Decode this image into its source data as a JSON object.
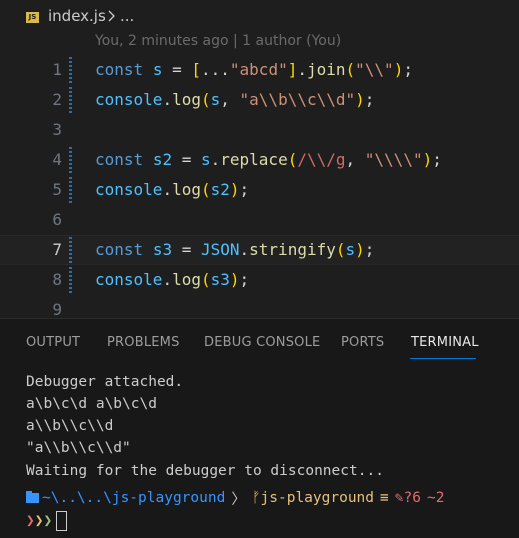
{
  "breadcrumb": {
    "file_badge": "JS",
    "file_name": "index.js",
    "more": "..."
  },
  "editor": {
    "blame": "You, 2 minutes ago | 1 author (You)",
    "active_line": 7,
    "lines": [
      {
        "number": "1",
        "modified": true
      },
      {
        "number": "2",
        "modified": true
      },
      {
        "number": "3",
        "modified": false
      },
      {
        "number": "4",
        "modified": true
      },
      {
        "number": "5",
        "modified": true
      },
      {
        "number": "6",
        "modified": false
      },
      {
        "number": "7",
        "modified": true
      },
      {
        "number": "8",
        "modified": true
      },
      {
        "number": "9",
        "modified": false
      }
    ],
    "code": {
      "l1": {
        "kw": "const",
        "var": "s",
        "eq": " = ",
        "b1o": "[",
        "spread": "...",
        "str": "\"abcd\"",
        "b1c": "]",
        "dot": ".",
        "fn": "join",
        "b2o": "(",
        "arg": "\"\\\\\"",
        "b2c": ")",
        "end": ";"
      },
      "l2": {
        "obj": "console",
        "dot": ".",
        "fn": "log",
        "b1o": "(",
        "var": "s",
        "comma": ", ",
        "str": "\"a\\\\b\\\\c\\\\d\"",
        "b1c": ")",
        "end": ";"
      },
      "l4": {
        "kw": "const",
        "var": "s2",
        "eq": " = ",
        "obj": "s",
        "dot": ".",
        "fn": "replace",
        "b1o": "(",
        "re": "/\\\\/g",
        "comma": ", ",
        "str": "\"\\\\\\\\\"",
        "b1c": ")",
        "end": ";"
      },
      "l5": {
        "obj": "console",
        "dot": ".",
        "fn": "log",
        "b1o": "(",
        "var": "s2",
        "b1c": ")",
        "end": ";"
      },
      "l7": {
        "kw": "const",
        "var": "s3",
        "eq": " = ",
        "obj": "JSON",
        "dot": ".",
        "fn": "stringify",
        "b1o": "(",
        "arg": "s",
        "b1c": ")",
        "end": ";"
      },
      "l8": {
        "obj": "console",
        "dot": ".",
        "fn": "log",
        "b1o": "(",
        "var": "s3",
        "b1c": ")",
        "end": ";"
      }
    }
  },
  "panel": {
    "tabs": [
      {
        "label": "OUTPUT",
        "active": false
      },
      {
        "label": "PROBLEMS",
        "active": false
      },
      {
        "label": "DEBUG CONSOLE",
        "active": false
      },
      {
        "label": "PORTS",
        "active": false
      },
      {
        "label": "TERMINAL",
        "active": true
      }
    ],
    "terminal": {
      "lines": [
        "Debugger attached.",
        "a\\b\\c\\d a\\b\\c\\d",
        "a\\\\b\\\\c\\\\d",
        "\"a\\\\b\\\\c\\\\d\"",
        "Waiting for the debugger to disconnect..."
      ],
      "prompt": {
        "path": "~\\..\\..\\js-playground",
        "separator": "〉",
        "branch_icon": "ᚠ",
        "branch": "js-playground",
        "status_eq": "≡",
        "edit_icon": "✎",
        "untracked": "?6",
        "modified": "~2"
      },
      "input_prompt": "❯❯❯"
    }
  },
  "colors": {
    "background": "#1e1e1e",
    "panel_background": "#181818",
    "keyword": "#569cd6",
    "variable": "#4fc1ff",
    "function": "#dcdcaa",
    "string": "#ce9178",
    "regex": "#d16969",
    "accent": "#0078d4"
  }
}
